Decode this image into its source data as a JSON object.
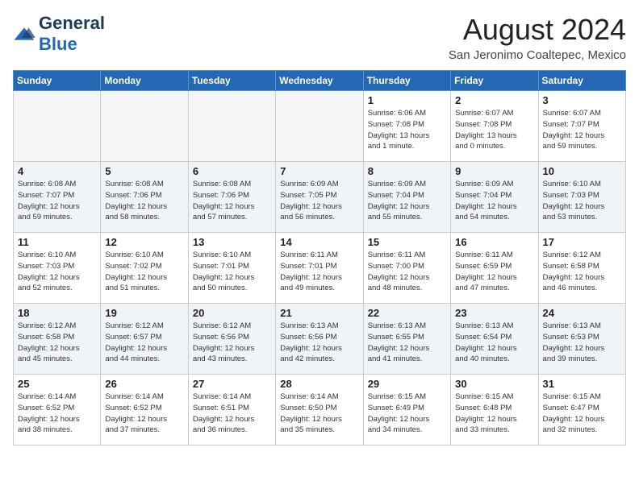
{
  "header": {
    "logo_general": "General",
    "logo_blue": "Blue",
    "month_title": "August 2024",
    "location": "San Jeronimo Coaltepec, Mexico"
  },
  "days_of_week": [
    "Sunday",
    "Monday",
    "Tuesday",
    "Wednesday",
    "Thursday",
    "Friday",
    "Saturday"
  ],
  "weeks": [
    [
      {
        "day": "",
        "info": ""
      },
      {
        "day": "",
        "info": ""
      },
      {
        "day": "",
        "info": ""
      },
      {
        "day": "",
        "info": ""
      },
      {
        "day": "1",
        "info": "Sunrise: 6:06 AM\nSunset: 7:08 PM\nDaylight: 13 hours\nand 1 minute."
      },
      {
        "day": "2",
        "info": "Sunrise: 6:07 AM\nSunset: 7:08 PM\nDaylight: 13 hours\nand 0 minutes."
      },
      {
        "day": "3",
        "info": "Sunrise: 6:07 AM\nSunset: 7:07 PM\nDaylight: 12 hours\nand 59 minutes."
      }
    ],
    [
      {
        "day": "4",
        "info": "Sunrise: 6:08 AM\nSunset: 7:07 PM\nDaylight: 12 hours\nand 59 minutes."
      },
      {
        "day": "5",
        "info": "Sunrise: 6:08 AM\nSunset: 7:06 PM\nDaylight: 12 hours\nand 58 minutes."
      },
      {
        "day": "6",
        "info": "Sunrise: 6:08 AM\nSunset: 7:06 PM\nDaylight: 12 hours\nand 57 minutes."
      },
      {
        "day": "7",
        "info": "Sunrise: 6:09 AM\nSunset: 7:05 PM\nDaylight: 12 hours\nand 56 minutes."
      },
      {
        "day": "8",
        "info": "Sunrise: 6:09 AM\nSunset: 7:04 PM\nDaylight: 12 hours\nand 55 minutes."
      },
      {
        "day": "9",
        "info": "Sunrise: 6:09 AM\nSunset: 7:04 PM\nDaylight: 12 hours\nand 54 minutes."
      },
      {
        "day": "10",
        "info": "Sunrise: 6:10 AM\nSunset: 7:03 PM\nDaylight: 12 hours\nand 53 minutes."
      }
    ],
    [
      {
        "day": "11",
        "info": "Sunrise: 6:10 AM\nSunset: 7:03 PM\nDaylight: 12 hours\nand 52 minutes."
      },
      {
        "day": "12",
        "info": "Sunrise: 6:10 AM\nSunset: 7:02 PM\nDaylight: 12 hours\nand 51 minutes."
      },
      {
        "day": "13",
        "info": "Sunrise: 6:10 AM\nSunset: 7:01 PM\nDaylight: 12 hours\nand 50 minutes."
      },
      {
        "day": "14",
        "info": "Sunrise: 6:11 AM\nSunset: 7:01 PM\nDaylight: 12 hours\nand 49 minutes."
      },
      {
        "day": "15",
        "info": "Sunrise: 6:11 AM\nSunset: 7:00 PM\nDaylight: 12 hours\nand 48 minutes."
      },
      {
        "day": "16",
        "info": "Sunrise: 6:11 AM\nSunset: 6:59 PM\nDaylight: 12 hours\nand 47 minutes."
      },
      {
        "day": "17",
        "info": "Sunrise: 6:12 AM\nSunset: 6:58 PM\nDaylight: 12 hours\nand 46 minutes."
      }
    ],
    [
      {
        "day": "18",
        "info": "Sunrise: 6:12 AM\nSunset: 6:58 PM\nDaylight: 12 hours\nand 45 minutes."
      },
      {
        "day": "19",
        "info": "Sunrise: 6:12 AM\nSunset: 6:57 PM\nDaylight: 12 hours\nand 44 minutes."
      },
      {
        "day": "20",
        "info": "Sunrise: 6:12 AM\nSunset: 6:56 PM\nDaylight: 12 hours\nand 43 minutes."
      },
      {
        "day": "21",
        "info": "Sunrise: 6:13 AM\nSunset: 6:56 PM\nDaylight: 12 hours\nand 42 minutes."
      },
      {
        "day": "22",
        "info": "Sunrise: 6:13 AM\nSunset: 6:55 PM\nDaylight: 12 hours\nand 41 minutes."
      },
      {
        "day": "23",
        "info": "Sunrise: 6:13 AM\nSunset: 6:54 PM\nDaylight: 12 hours\nand 40 minutes."
      },
      {
        "day": "24",
        "info": "Sunrise: 6:13 AM\nSunset: 6:53 PM\nDaylight: 12 hours\nand 39 minutes."
      }
    ],
    [
      {
        "day": "25",
        "info": "Sunrise: 6:14 AM\nSunset: 6:52 PM\nDaylight: 12 hours\nand 38 minutes."
      },
      {
        "day": "26",
        "info": "Sunrise: 6:14 AM\nSunset: 6:52 PM\nDaylight: 12 hours\nand 37 minutes."
      },
      {
        "day": "27",
        "info": "Sunrise: 6:14 AM\nSunset: 6:51 PM\nDaylight: 12 hours\nand 36 minutes."
      },
      {
        "day": "28",
        "info": "Sunrise: 6:14 AM\nSunset: 6:50 PM\nDaylight: 12 hours\nand 35 minutes."
      },
      {
        "day": "29",
        "info": "Sunrise: 6:15 AM\nSunset: 6:49 PM\nDaylight: 12 hours\nand 34 minutes."
      },
      {
        "day": "30",
        "info": "Sunrise: 6:15 AM\nSunset: 6:48 PM\nDaylight: 12 hours\nand 33 minutes."
      },
      {
        "day": "31",
        "info": "Sunrise: 6:15 AM\nSunset: 6:47 PM\nDaylight: 12 hours\nand 32 minutes."
      }
    ]
  ]
}
